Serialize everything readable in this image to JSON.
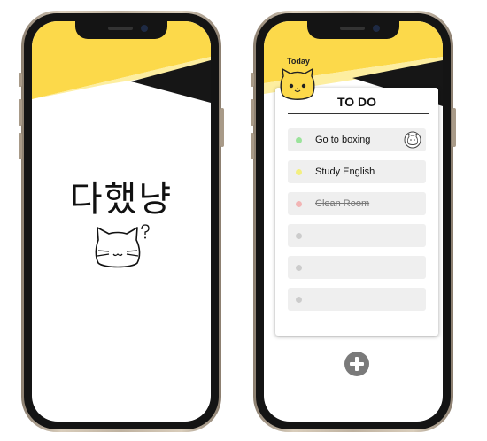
{
  "splash": {
    "app_title": "다했냥",
    "cat_icon": "cat-question-icon"
  },
  "todo": {
    "today_label": "Today",
    "header_title": "TO DO",
    "tasks": [
      {
        "label": "Go to boxing",
        "status_color": "#9be39b",
        "done": false,
        "badge": "cat-badge-icon"
      },
      {
        "label": "Study English",
        "status_color": "#f3ef80",
        "done": false
      },
      {
        "label": "Clean Room",
        "status_color": "#f2b5b5",
        "done": true
      },
      {
        "label": "",
        "status_color": "#cccccc",
        "done": false
      },
      {
        "label": "",
        "status_color": "#cccccc",
        "done": false
      },
      {
        "label": "",
        "status_color": "#cccccc",
        "done": false
      }
    ],
    "add_icon": "plus-circle-icon"
  },
  "colors": {
    "accent_yellow": "#fcd94a",
    "light_yellow": "#fdeea0",
    "dark": "#161616"
  }
}
